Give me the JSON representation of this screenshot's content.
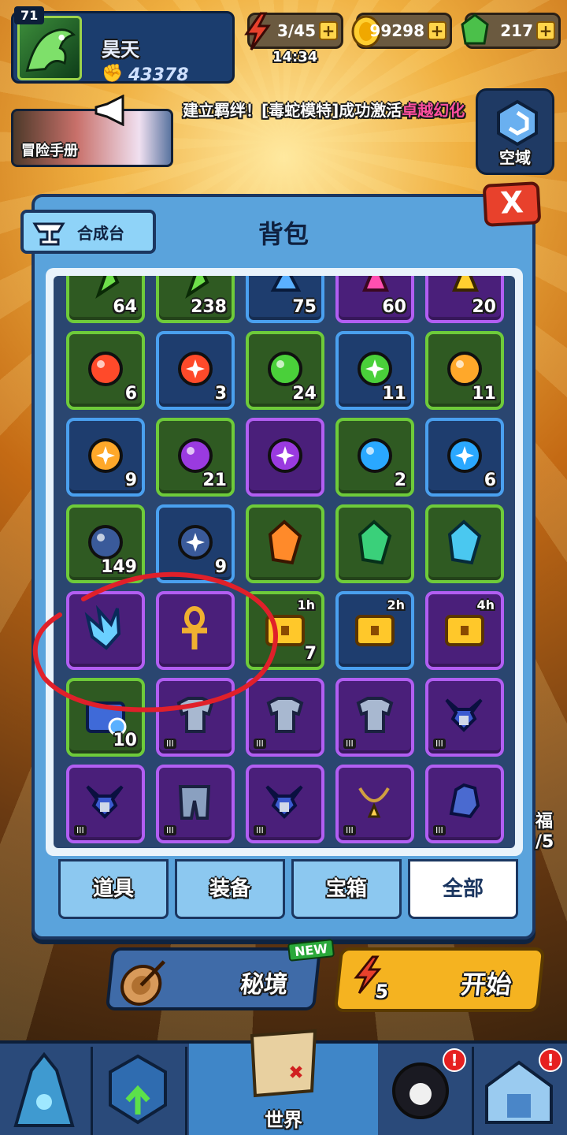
{
  "player": {
    "level": "71",
    "name": "昊天",
    "power": "43378"
  },
  "resources": {
    "energy": "3/45",
    "gold": "99298",
    "gems": "217",
    "timer": "14:34",
    "plus": "+"
  },
  "adventure_label": "冒险手册",
  "notice": {
    "prefix": "建立羁绊！[毒蛇模特]成功激活",
    "highlight": "卓越幻化"
  },
  "void_label": "空域",
  "panel": {
    "title": "背包",
    "craft_label": "合成台",
    "close": "X"
  },
  "items": [
    {
      "q": "green",
      "count": "64",
      "gfx": "gem-green"
    },
    {
      "q": "green",
      "count": "238",
      "gfx": "gem-green"
    },
    {
      "q": "blue",
      "count": "75",
      "gfx": "gem-blue"
    },
    {
      "q": "purple",
      "count": "60",
      "gfx": "gem-pink"
    },
    {
      "q": "purple",
      "count": "20",
      "gfx": "gem-gold"
    },
    {
      "q": "green",
      "count": "6",
      "gfx": "orb-red"
    },
    {
      "q": "blue",
      "count": "3",
      "gfx": "orb-red-star"
    },
    {
      "q": "green",
      "count": "24",
      "gfx": "orb-green"
    },
    {
      "q": "blue",
      "count": "11",
      "gfx": "orb-green-star"
    },
    {
      "q": "green",
      "count": "11",
      "gfx": "orb-orange"
    },
    {
      "q": "blue",
      "count": "9",
      "gfx": "orb-orange-star"
    },
    {
      "q": "green",
      "count": "21",
      "gfx": "orb-purple"
    },
    {
      "q": "purple",
      "count": "",
      "gfx": "orb-purple-star"
    },
    {
      "q": "green",
      "count": "2",
      "gfx": "orb-blue"
    },
    {
      "q": "blue",
      "count": "6",
      "gfx": "orb-blue-star"
    },
    {
      "q": "green",
      "count": "149",
      "gfx": "orb-navy"
    },
    {
      "q": "blue",
      "count": "9",
      "gfx": "orb-navy-star"
    },
    {
      "q": "green",
      "count": "",
      "gfx": "crystal-orange"
    },
    {
      "q": "green",
      "count": "",
      "gfx": "crystal-green"
    },
    {
      "q": "green",
      "count": "",
      "gfx": "crystal-cyan"
    },
    {
      "q": "purple",
      "count": "",
      "gfx": "ice-shard"
    },
    {
      "q": "purple",
      "count": "",
      "gfx": "ankh"
    },
    {
      "q": "green",
      "count": "7",
      "gfx": "chest-gold",
      "time": "1h"
    },
    {
      "q": "blue",
      "count": "",
      "gfx": "chest-gold",
      "time": "2h"
    },
    {
      "q": "purple",
      "count": "",
      "gfx": "chest-gold",
      "time": "4h"
    },
    {
      "q": "green",
      "count": "10",
      "gfx": "chest-blue"
    },
    {
      "q": "purple",
      "count": "",
      "gfx": "armor",
      "tier": "III"
    },
    {
      "q": "purple",
      "count": "",
      "gfx": "armor",
      "tier": "III"
    },
    {
      "q": "purple",
      "count": "",
      "gfx": "armor",
      "tier": "III"
    },
    {
      "q": "purple",
      "count": "",
      "gfx": "helmet",
      "tier": "III"
    },
    {
      "q": "purple",
      "count": "",
      "gfx": "helmet",
      "tier": "III"
    },
    {
      "q": "purple",
      "count": "",
      "gfx": "pants",
      "tier": "III"
    },
    {
      "q": "purple",
      "count": "",
      "gfx": "helmet",
      "tier": "III"
    },
    {
      "q": "purple",
      "count": "",
      "gfx": "necklace",
      "tier": "III"
    },
    {
      "q": "purple",
      "count": "",
      "gfx": "glove",
      "tier": "III"
    }
  ],
  "tabs": [
    {
      "label": "道具",
      "active": false
    },
    {
      "label": "装备",
      "active": false
    },
    {
      "label": "宝箱",
      "active": false
    },
    {
      "label": "全部",
      "active": true
    }
  ],
  "mystic": {
    "label": "秘境",
    "new": "NEW"
  },
  "start": {
    "label": "开始",
    "cost": "5"
  },
  "nav": {
    "world": "世界",
    "badge": "!"
  },
  "side": {
    "blessing": "福",
    "fraction": "/5"
  },
  "colors": {
    "green_border": "#6ecb3a",
    "blue_border": "#4aa0ef",
    "purple_border": "#b25ef2",
    "highlight": "#ff4fa0",
    "annotation": "#e0202a"
  }
}
